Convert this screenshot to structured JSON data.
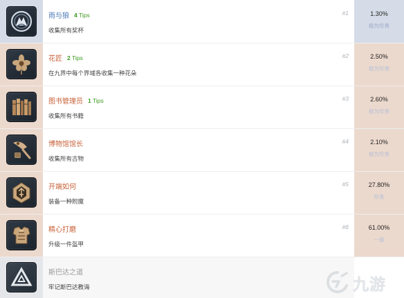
{
  "achievements": [
    {
      "title": "雨与狼",
      "tips_count": "4",
      "tips_word": "Tips",
      "description": "收集所有奖杯",
      "number": "#1",
      "percent": "1.30%",
      "rarity": "极为珍贵",
      "icon": "wolf-emblem-icon",
      "style": "blue"
    },
    {
      "title": "花匠",
      "tips_count": "2",
      "tips_word": "Tips",
      "description": "在九界中每个界域各收集一种花朵",
      "number": "#2",
      "percent": "2.50%",
      "rarity": "极为珍贵",
      "icon": "flower-icon",
      "style": "rare"
    },
    {
      "title": "图书管理员",
      "tips_count": "1",
      "tips_word": "Tips",
      "description": "收集所有书籍",
      "number": "#3",
      "percent": "2.60%",
      "rarity": "极为珍贵",
      "icon": "books-icon",
      "style": "rare"
    },
    {
      "title": "博物馆馆长",
      "description": "收集所有古物",
      "number": "#4",
      "percent": "2.10%",
      "rarity": "极为珍贵",
      "icon": "artifacts-icon",
      "style": "rare"
    },
    {
      "title": "开端如何",
      "description": "装备一种附魔",
      "number": "#5",
      "percent": "27.80%",
      "rarity": "珍贵",
      "icon": "enchantment-icon",
      "style": "rare"
    },
    {
      "title": "精心打磨",
      "description": "升级一件盔甲",
      "number": "#6",
      "percent": "61.00%",
      "rarity": "一般",
      "icon": "armor-icon",
      "style": "rare"
    },
    {
      "title": "斯巴达之道",
      "description": "牢记斯巴达教诲",
      "icon": "spartan-triangle-icon",
      "style": "locked"
    }
  ],
  "watermark": {
    "text": "九游",
    "icon": "jiuyou-logo-icon"
  }
}
